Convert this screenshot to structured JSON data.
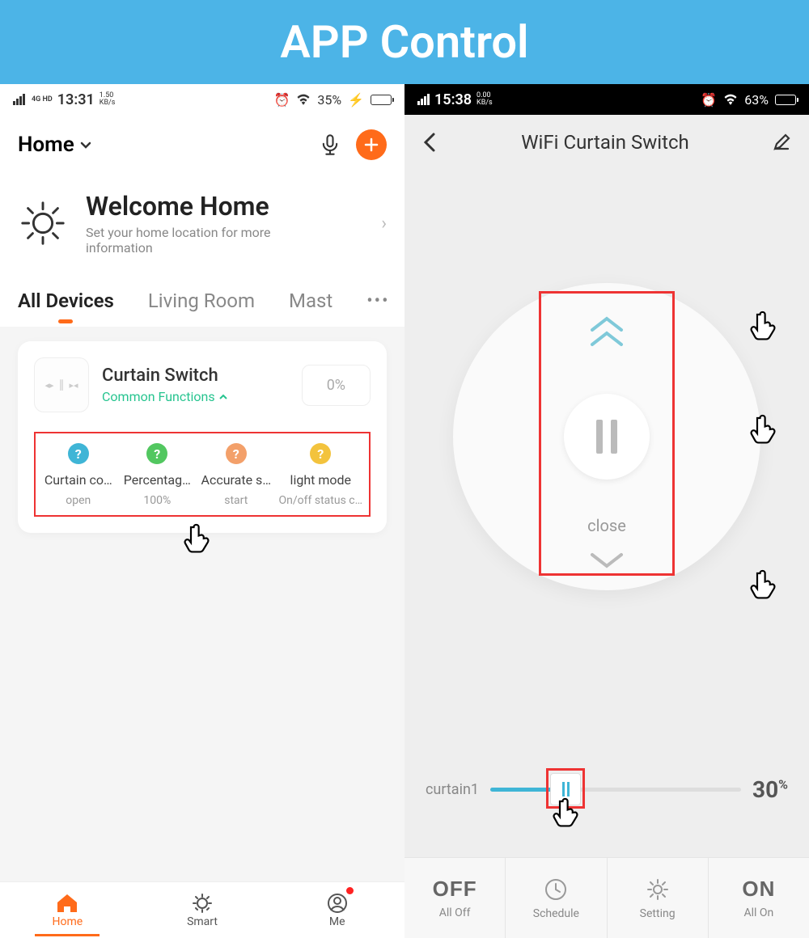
{
  "banner": {
    "title": "APP Control"
  },
  "left": {
    "status": {
      "time": "13:31",
      "kb": "1.50",
      "kb_unit": "KB/s",
      "net": "4G HD",
      "battery_pct": "35%",
      "battery_fill": 35
    },
    "header": {
      "home_label": "Home",
      "mic_icon": "mic",
      "add_icon": "plus"
    },
    "welcome": {
      "title": "Welcome Home",
      "subtitle": "Set your home location for more information"
    },
    "tabs": [
      {
        "label": "All Devices",
        "active": true
      },
      {
        "label": "Living Room",
        "active": false
      },
      {
        "label": "Mast",
        "active": false
      }
    ],
    "device": {
      "name": "Curtain Switch",
      "common_label": "Common Functions",
      "pct": "0%",
      "functions": [
        {
          "label": "Curtain co…",
          "value": "open",
          "color": "#3fb5d6"
        },
        {
          "label": "Percentag…",
          "value": "100%",
          "color": "#52c760"
        },
        {
          "label": "Accurate s…",
          "value": "start",
          "color": "#f3a06a"
        },
        {
          "label": "light mode",
          "value": "On/off status c…",
          "color": "#f3c33d"
        }
      ]
    },
    "bottomnav": [
      {
        "label": "Home",
        "icon": "home",
        "active": true,
        "dot": false
      },
      {
        "label": "Smart",
        "icon": "smart",
        "active": false,
        "dot": false
      },
      {
        "label": "Me",
        "icon": "me",
        "active": false,
        "dot": true
      }
    ]
  },
  "right": {
    "status": {
      "time": "15:38",
      "kb": "0.00",
      "kb_unit": "KB/s",
      "battery_pct": "63%",
      "battery_fill": 63
    },
    "header": {
      "title": "WiFi Curtain Switch"
    },
    "dial": {
      "close_label": "close"
    },
    "slider": {
      "label": "curtain1",
      "pct": "30",
      "pct_unit": "%",
      "fill": 30
    },
    "bottombar": {
      "off_big": "OFF",
      "off_small": "All Off",
      "schedule": "Schedule",
      "setting": "Setting",
      "on_big": "ON",
      "on_small": "All On"
    }
  }
}
